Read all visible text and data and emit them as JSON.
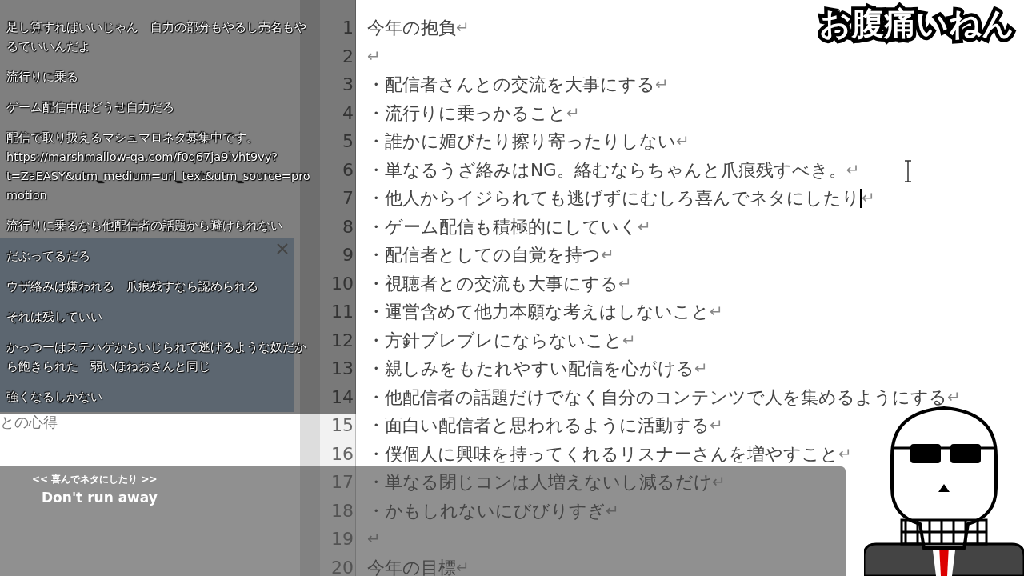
{
  "title": "お腹痛いねん",
  "background_app": {
    "ghost_texts": [
      "との心得"
    ]
  },
  "chat_overlay": {
    "messages": [
      "足し算すればいいじゃん　自力の部分もやるし売名もやるでいいんだよ",
      "流行りに乗る",
      "ゲーム配信中はどうせ自力だろ",
      "配信で取り扱えるマシュマロネタ募集中です。https://marshmallow-qa.com/f0q67ja9ivht9vy?t=ZaEASY&utm_medium=url_text&utm_source=promotion",
      "流行りに乗るなら他配信者の話題から避けられない",
      "だぶってるだろ",
      "ウザ絡みは嫌われる　爪痕残すなら認められる",
      "それは残していい",
      "かっつーはステハゲからいじられて逃げるような奴だから飽きられた　弱いほねおさんと同じ",
      "強くなるしかない"
    ]
  },
  "editor": {
    "lines": [
      {
        "number": "1",
        "text": "今年の抱負",
        "mark": "↵",
        "cursor": false
      },
      {
        "number": "2",
        "mark": "↵",
        "cursor": false
      },
      {
        "number": "3",
        "text": "・配信者さんとの交流を大事にする",
        "mark": "↵",
        "cursor": false
      },
      {
        "number": "4",
        "text": "・流行りに乗っかること",
        "mark": "↵",
        "cursor": false
      },
      {
        "number": "5",
        "text": "・誰かに媚びたり擦り寄ったりしない",
        "mark": "↵",
        "cursor": false
      },
      {
        "number": "6",
        "text": "・単なるうざ絡みはNG。絡むならちゃんと爪痕残すべき。",
        "mark": "↵",
        "cursor": false
      },
      {
        "number": "7",
        "text": "・他人からイジられても逃げずにむしろ喜んでネタにしたり",
        "mark": "↵",
        "cursor": true
      },
      {
        "number": "8",
        "text": "・ゲーム配信も積極的にしていく",
        "mark": "↵",
        "cursor": false
      },
      {
        "number": "9",
        "text": "・配信者としての自覚を持つ",
        "mark": "↵",
        "cursor": false
      },
      {
        "number": "10",
        "text": "・視聴者との交流も大事にする",
        "mark": "↵",
        "cursor": false
      },
      {
        "number": "11",
        "text": "・運営含めて他力本願な考えはしないこと",
        "mark": "↵",
        "cursor": false
      },
      {
        "number": "12",
        "text": "・方針ブレブレにならないこと",
        "mark": "↵",
        "cursor": false
      },
      {
        "number": "13",
        "text": "・親しみをもたれやすい配信を心がける",
        "mark": "↵",
        "cursor": false
      },
      {
        "number": "14",
        "text": "・他配信者の話題だけでなく自分のコンテンツで人を集めるようにする",
        "mark": "↵",
        "cursor": false
      },
      {
        "number": "15",
        "text": "・面白い配信者と思われるように活動する",
        "mark": "↵",
        "cursor": false
      },
      {
        "number": "16",
        "text": "・僕個人に興味を持ってくれるリスナーさんを増やすこと",
        "mark": "↵",
        "cursor": false
      },
      {
        "number": "17",
        "text": "・単なる閉じコンは人増えないし減るだけ",
        "mark": "↵",
        "cursor": false
      },
      {
        "number": "18",
        "text": "・かもしれないにびびりすぎ",
        "mark": "↵",
        "cursor": false
      },
      {
        "number": "19",
        "mark": "↵",
        "cursor": false
      },
      {
        "number": "20",
        "text": "今年の目標",
        "mark": "↵",
        "cursor": false
      }
    ]
  },
  "subtitle": {
    "source": "<< 喜んでネタにしたり >>",
    "translation": "Don't run away"
  }
}
